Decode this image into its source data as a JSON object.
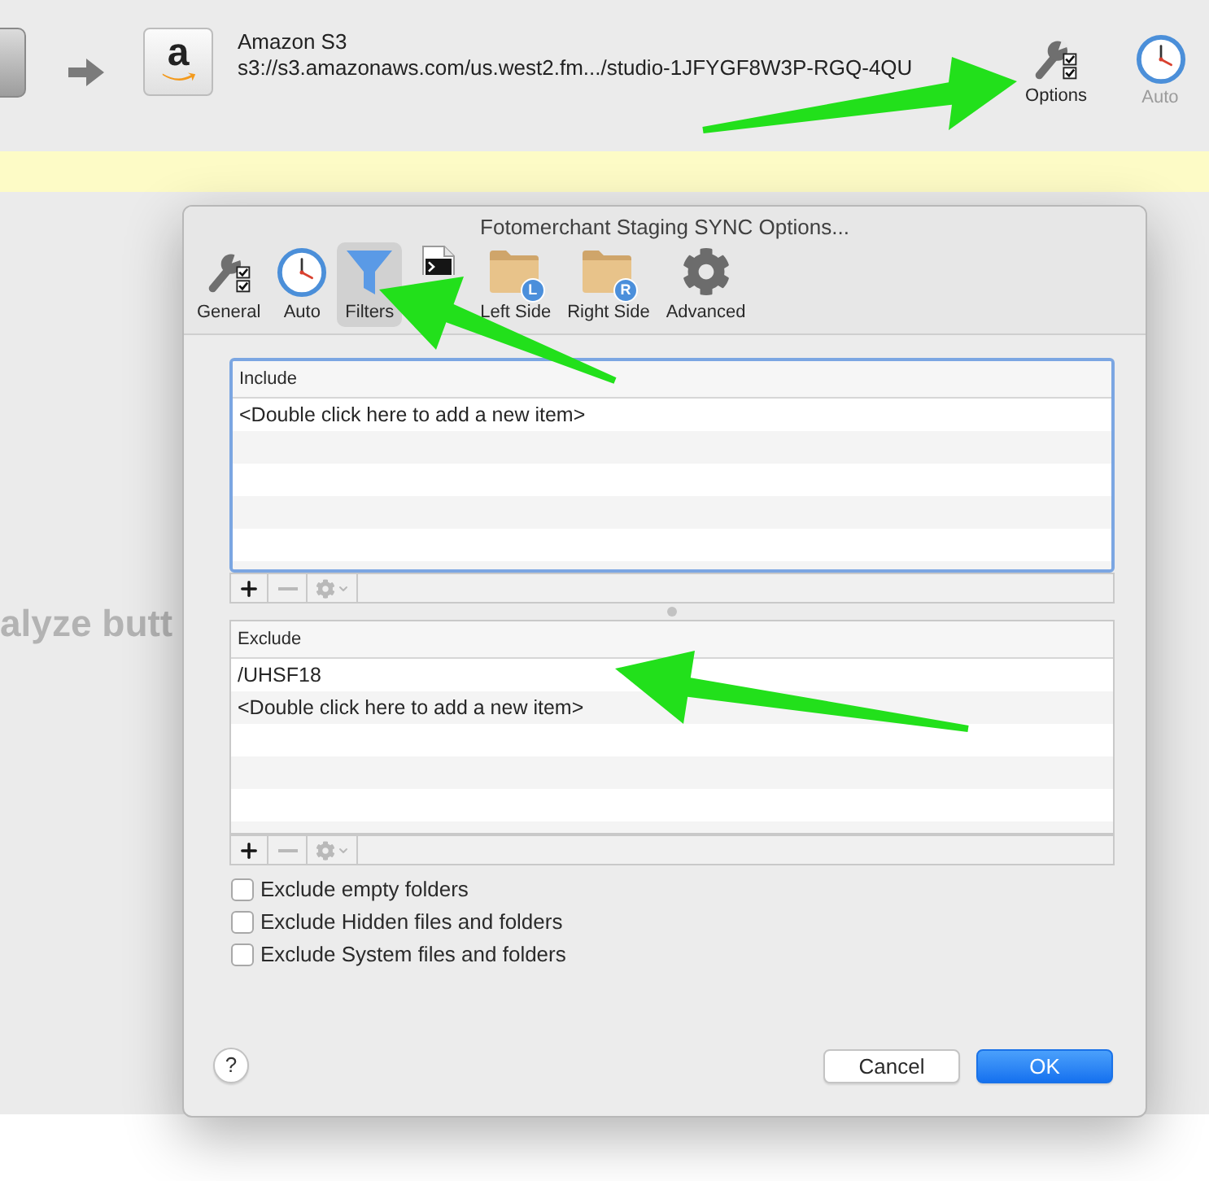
{
  "destination": {
    "logo_letter": "a",
    "name": "Amazon S3",
    "path": "s3://s3.amazonaws.com/us.west2.fm.../studio-1JFYGF8W3P-RGQ-4QU"
  },
  "toolbar_buttons": [
    {
      "kind": "options",
      "label": "Options",
      "disabled": false
    },
    {
      "kind": "clock",
      "label": "Auto",
      "disabled": true
    }
  ],
  "background_text": "alyze butt",
  "dialog": {
    "title": "Fotomerchant Staging SYNC Options...",
    "tabs": [
      {
        "kind": "general",
        "label": "General",
        "selected": false
      },
      {
        "kind": "clock",
        "label": "Auto",
        "selected": false
      },
      {
        "kind": "filter",
        "label": "Filters",
        "selected": true
      },
      {
        "kind": "script",
        "selected": false
      },
      {
        "kind": "folder",
        "badge": "L",
        "label": "Left Side",
        "selected": false
      },
      {
        "kind": "folder",
        "badge": "R",
        "label": "Right Side",
        "selected": false
      },
      {
        "kind": "gear",
        "label": "Advanced",
        "selected": false
      }
    ],
    "include": {
      "heading": "Include",
      "focused": true,
      "rows": [
        "<Double click here to add a new item>"
      ],
      "buttons": [
        {
          "kind": "add",
          "disabled": false
        },
        {
          "kind": "remove",
          "disabled": true
        },
        {
          "kind": "actions",
          "disabled": true
        }
      ]
    },
    "exclude": {
      "heading": "Exclude",
      "focused": false,
      "rows": [
        "/UHSF18",
        "<Double click here to add a new item>"
      ],
      "buttons": [
        {
          "kind": "add",
          "disabled": false
        },
        {
          "kind": "remove",
          "disabled": true
        },
        {
          "kind": "actions",
          "disabled": true
        }
      ]
    },
    "checkboxes": [
      {
        "label": "Exclude empty folders",
        "checked": false
      },
      {
        "label": "Exclude Hidden files and folders",
        "checked": false
      },
      {
        "label": "Exclude System files and folders",
        "checked": false
      }
    ],
    "help": "?",
    "buttons": [
      {
        "label": "Cancel",
        "default": false
      },
      {
        "label": "OK",
        "default": true
      }
    ]
  }
}
